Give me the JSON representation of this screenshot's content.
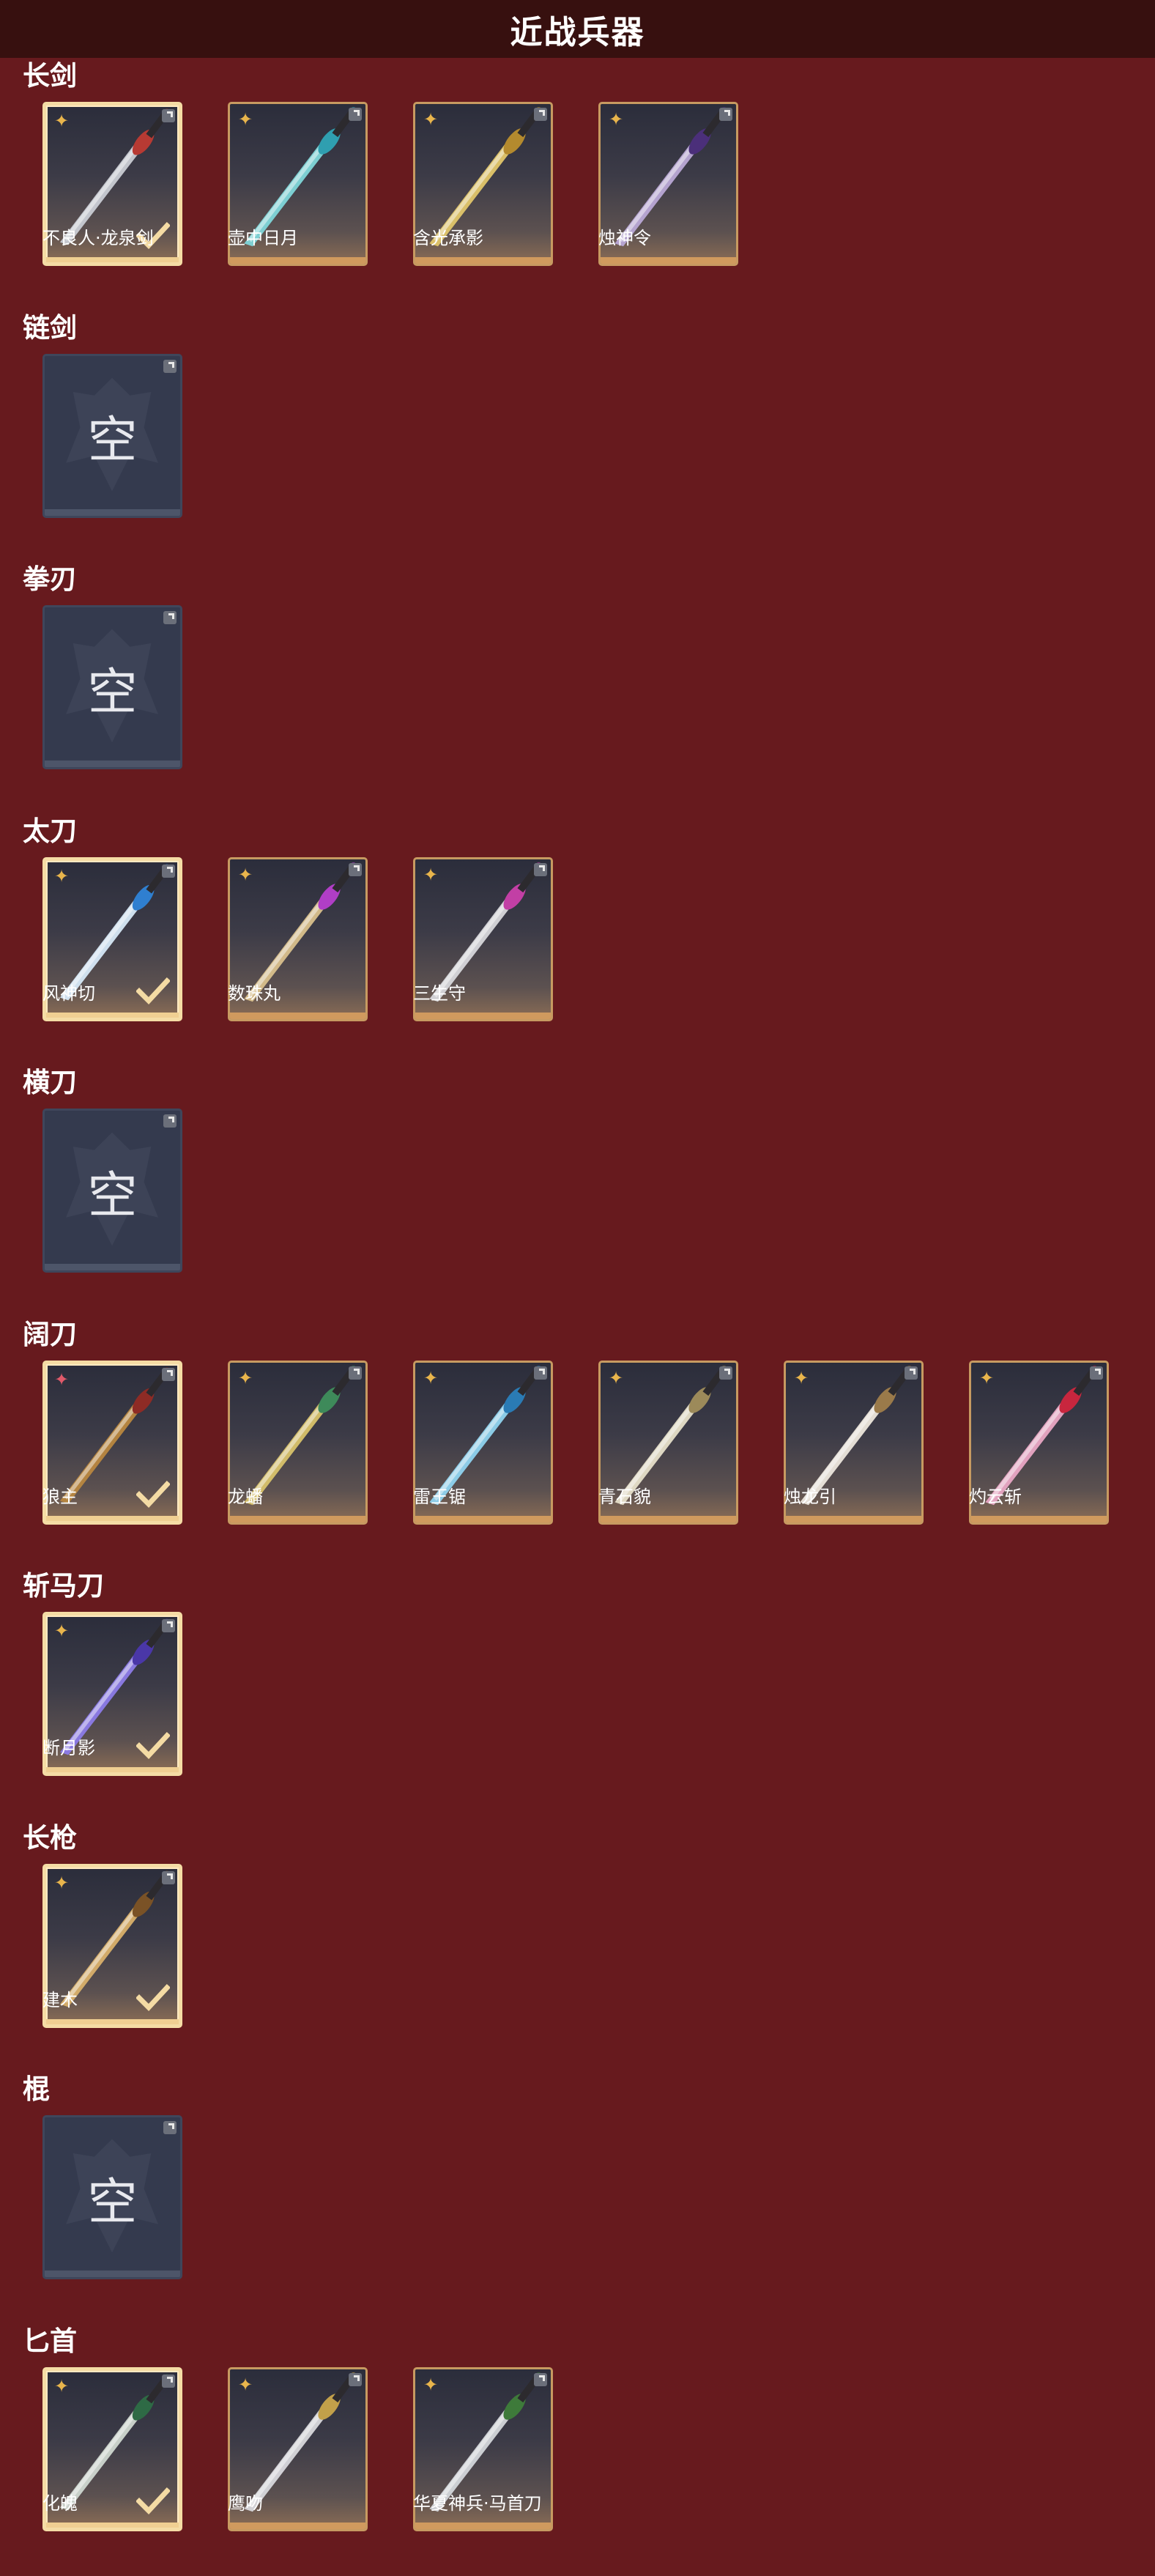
{
  "page": {
    "title": "近战兵器"
  },
  "colors": {
    "background": "#671a1e",
    "header": "#37100f",
    "frame_gold": "#c79a61",
    "frame_equipped": "#f5dca5",
    "rarity_gold": "#e9b54c",
    "rarity_red": "#e05a6a",
    "empty_slot": "#343a4e"
  },
  "categories": [
    {
      "label": "长剑",
      "items": [
        {
          "name": "不良人·龙泉剑",
          "equipped": true,
          "rarity": "gold",
          "blade": "#c9ccd4",
          "accent": "#b73a33"
        },
        {
          "name": "壶中日月",
          "equipped": false,
          "rarity": "gold",
          "blade": "#7fd6d9",
          "accent": "#2f9fb0"
        },
        {
          "name": "含光承影",
          "equipped": false,
          "rarity": "gold",
          "blade": "#e2c66a",
          "accent": "#b48a2e"
        },
        {
          "name": "烛神令",
          "equipped": false,
          "rarity": "gold",
          "blade": "#b9a8d6",
          "accent": "#4b2f7a"
        }
      ]
    },
    {
      "label": "链剑",
      "items": [
        {
          "empty": true,
          "empty_text": "空"
        }
      ]
    },
    {
      "label": "拳刃",
      "items": [
        {
          "empty": true,
          "empty_text": "空"
        }
      ]
    },
    {
      "label": "太刀",
      "items": [
        {
          "name": "风神切",
          "equipped": true,
          "rarity": "gold",
          "blade": "#d6e8f7",
          "accent": "#2f7fd0"
        },
        {
          "name": "数珠丸",
          "equipped": false,
          "rarity": "gold",
          "blade": "#d9c08c",
          "accent": "#b03ec6"
        },
        {
          "name": "三生守",
          "equipped": false,
          "rarity": "gold",
          "blade": "#d7d7db",
          "accent": "#c23fa5"
        }
      ]
    },
    {
      "label": "横刀",
      "items": [
        {
          "empty": true,
          "empty_text": "空"
        }
      ]
    },
    {
      "label": "阔刀",
      "items": [
        {
          "name": "狼主",
          "equipped": true,
          "rarity": "red",
          "blade": "#b9873f",
          "accent": "#8e2b25"
        },
        {
          "name": "龙蟠",
          "equipped": false,
          "rarity": "gold",
          "blade": "#d8c26a",
          "accent": "#3e8a5a"
        },
        {
          "name": "雷王锯",
          "equipped": false,
          "rarity": "gold",
          "blade": "#8fd3ef",
          "accent": "#2a7bb5"
        },
        {
          "name": "青石貌",
          "equipped": false,
          "rarity": "gold",
          "blade": "#e6dfc9",
          "accent": "#9c8a5a"
        },
        {
          "name": "烛龙引",
          "equipped": false,
          "rarity": "gold",
          "blade": "#ece6dc",
          "accent": "#9a7a4a"
        },
        {
          "name": "灼云斩",
          "equipped": false,
          "rarity": "gold",
          "blade": "#e9a7c4",
          "accent": "#c8263e"
        }
      ]
    },
    {
      "label": "斩马刀",
      "items": [
        {
          "name": "断月影",
          "equipped": true,
          "rarity": "gold",
          "blade": "#8c7be8",
          "accent": "#4a37a8"
        }
      ]
    },
    {
      "label": "长枪",
      "items": [
        {
          "name": "建木",
          "equipped": true,
          "rarity": "gold",
          "blade": "#d9b06a",
          "accent": "#7a5226"
        }
      ]
    },
    {
      "label": "棍",
      "items": [
        {
          "empty": true,
          "empty_text": "空"
        }
      ]
    },
    {
      "label": "匕首",
      "items": [
        {
          "name": "化魄",
          "equipped": true,
          "rarity": "gold",
          "blade": "#cfd7d0",
          "accent": "#2e6a45"
        },
        {
          "name": "鹰吻",
          "equipped": false,
          "rarity": "gold",
          "blade": "#d8d8dc",
          "accent": "#c2a04a"
        },
        {
          "name": "华夏神兵·马首刀",
          "equipped": false,
          "rarity": "gold",
          "blade": "#d3d6da",
          "accent": "#3e7a3a"
        }
      ]
    }
  ]
}
